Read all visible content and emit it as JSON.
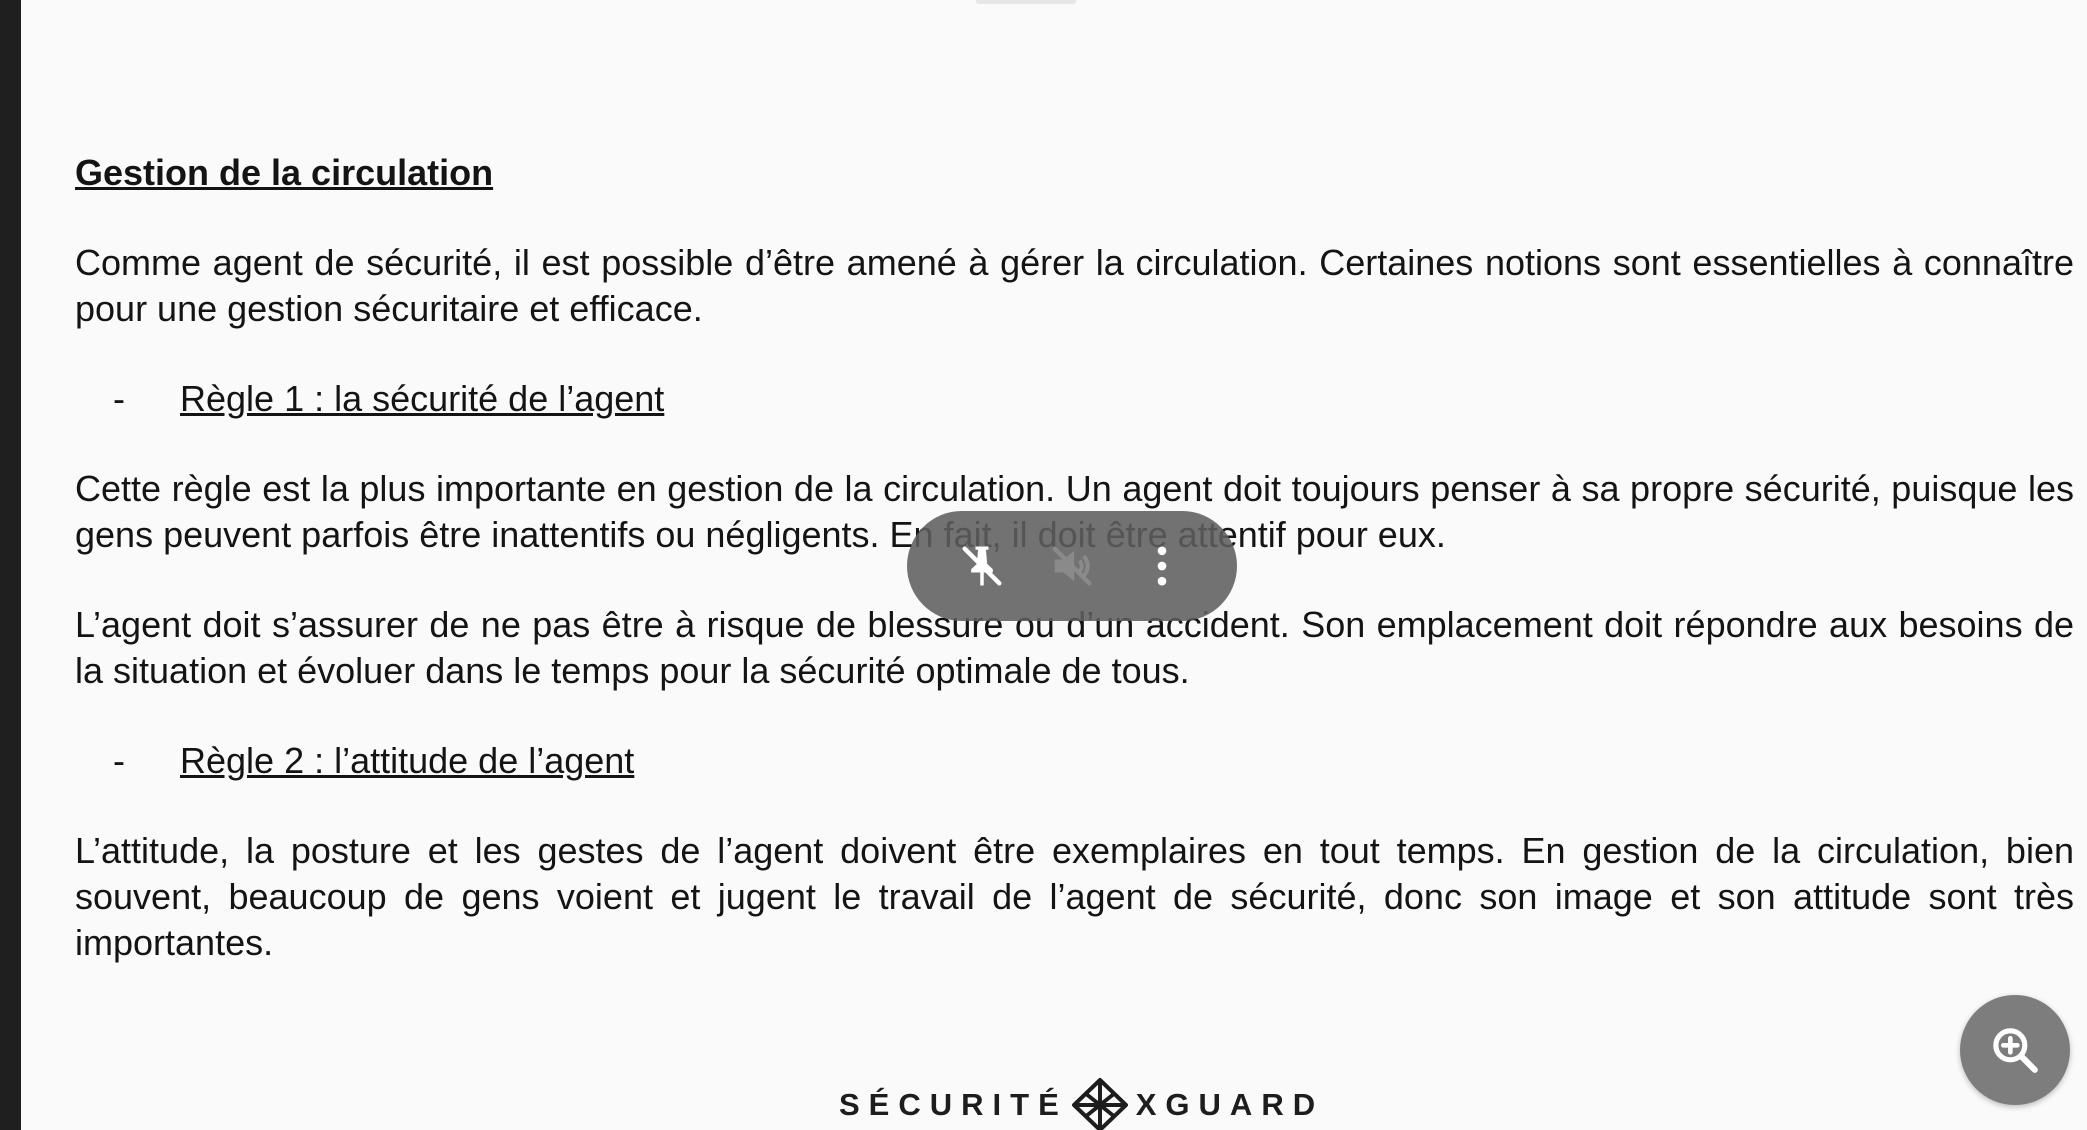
{
  "document": {
    "heading": "Gestion de la circulation",
    "intro": "Comme agent de sécurité, il est possible d’être amené à gérer la circulation. Certaines notions sont essentielles à connaître pour une gestion sécuritaire et efficace.",
    "rules": [
      {
        "bullet": "-",
        "title": "Règle 1 : la sécurité de l’agent",
        "paragraphs": [
          "Cette règle est la plus importante en gestion de la circulation. Un agent doit toujours penser à sa propre sécurité, puisque les gens peuvent parfois être inattentifs ou négligents. En fait, il doit être attentif pour eux.",
          "L’agent doit s’assurer de ne pas être à risque de blessure ou d’un accident. Son emplacement doit répondre aux besoins de la situation et évoluer dans le temps pour la sécurité optimale de tous."
        ]
      },
      {
        "bullet": "-",
        "title": "Règle 2 : l’attitude de l’agent",
        "paragraphs": [
          "L’attitude, la posture et les gestes de l’agent doivent être exemplaires en tout temps. En gestion de la circulation, bien souvent, beaucoup de gens voient et jugent le travail de l’agent de sécurité, donc son image et son attitude sont très importantes."
        ]
      }
    ]
  },
  "footer": {
    "brand_left": "SÉCURITÉ",
    "brand_right": "XGUARD"
  },
  "overlay": {
    "controls": [
      {
        "icon": "pin-off-icon"
      },
      {
        "icon": "volume-off-icon"
      },
      {
        "icon": "more-vert-icon"
      }
    ]
  },
  "zoom_button": {
    "icon": "zoom-in-icon"
  },
  "colors": {
    "page_background": "#fafafa",
    "viewer_background": "#1f1f1f",
    "text": "#141414",
    "overlay": "#5f5f5f",
    "fab": "#7d7d7d"
  }
}
